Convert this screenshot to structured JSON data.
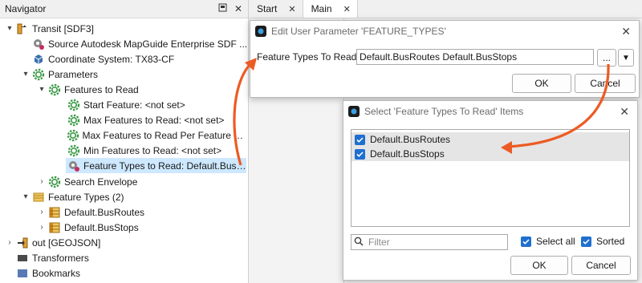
{
  "navigator": {
    "title": "Navigator",
    "header_icons": [
      "pin-icon",
      "close-icon"
    ],
    "tree": [
      {
        "label": "Transit [SDF3]",
        "icon": "reader-icon"
      },
      {
        "label": "Source Autodesk MapGuide Enterprise SDF ...",
        "icon": "gear-user-icon"
      },
      {
        "label": "Coordinate System: TX83-CF",
        "icon": "coordinate-icon"
      },
      {
        "label": "Parameters",
        "icon": "gear-icon"
      },
      {
        "label": "Features to Read",
        "icon": "gear-icon"
      },
      {
        "label": "Start Feature: <not set>",
        "icon": "gear-icon"
      },
      {
        "label": "Max Features to Read: <not set>",
        "icon": "gear-icon"
      },
      {
        "label": "Max Features to Read Per Feature Ty...",
        "icon": "gear-icon"
      },
      {
        "label": "Min Features to Read: <not set>",
        "icon": "gear-icon"
      },
      {
        "label": "Feature Types to Read: Default.BusR...",
        "icon": "gear-user-icon"
      },
      {
        "label": "Search Envelope",
        "icon": "gear-icon"
      },
      {
        "label": "Feature Types (2)",
        "icon": "folder-icon"
      },
      {
        "label": "Default.BusRoutes",
        "icon": "table-icon"
      },
      {
        "label": "Default.BusStops",
        "icon": "table-icon"
      },
      {
        "label": "out [GEOJSON]",
        "icon": "writer-icon"
      },
      {
        "label": "Transformers",
        "icon": "transformer-icon"
      },
      {
        "label": "Bookmarks",
        "icon": "bookmark-icon"
      }
    ]
  },
  "tabs": [
    {
      "label": "Start"
    },
    {
      "label": "Main"
    }
  ],
  "edit_dialog": {
    "title": "Edit User Parameter  'FEATURE_TYPES'",
    "field_label": "Feature Types To Read:",
    "field_value": "Default.BusRoutes Default.BusStops",
    "ellipsis_label": "...",
    "ok_label": "OK",
    "cancel_label": "Cancel"
  },
  "select_dialog": {
    "title": "Select 'Feature Types To Read' Items",
    "items": [
      {
        "label": "Default.BusRoutes",
        "checked": true
      },
      {
        "label": "Default.BusStops",
        "checked": true
      }
    ],
    "filter_placeholder": "Filter",
    "select_all_label": "Select all",
    "sorted_label": "Sorted",
    "ok_label": "OK",
    "cancel_label": "Cancel"
  },
  "colors": {
    "accent": "#1f6fd0",
    "annotation_arrow": "#ec5b24",
    "selection": "#cde8ff",
    "gear_green": "#3d9a48"
  }
}
